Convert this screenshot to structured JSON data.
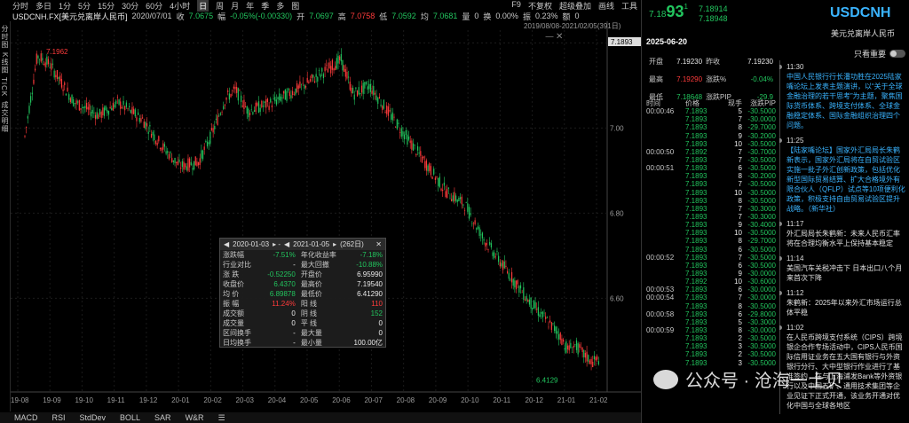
{
  "toolbar": {
    "items": [
      "分时",
      "多日",
      "1分",
      "5分",
      "15分",
      "30分",
      "60分",
      "4小时",
      "日",
      "周",
      "月",
      "年",
      "季",
      "多",
      "图"
    ],
    "active": "日",
    "right": [
      "F9",
      "不复权",
      "超级叠加",
      "画线",
      "工具"
    ]
  },
  "info": {
    "symbol": "USDCNH.FX[美元兑离岸人民币]",
    "date": "2020/07/01",
    "close_label": "收",
    "close": "7.0675",
    "chg_label": "幅",
    "chg": "-0.05%(-0.00330)",
    "open_label": "开",
    "open": "7.0697",
    "high_label": "高",
    "high": "7.0758",
    "low_label": "低",
    "low": "7.0592",
    "prev_label": "均",
    "prev": "7.0681",
    "vol_label": "量",
    "vol": "0",
    "turn_label": "换",
    "turn": "0.00%",
    "amp_label": "振",
    "amp": "0.23%",
    "amt_label": "额",
    "amt": "0"
  },
  "leftrail": [
    "分时图",
    "K线图",
    "TICK",
    "成交明细"
  ],
  "chart": {
    "range_label": "2019/08/08-2021/02/05(391日)",
    "current_price": "7.1893",
    "max_label": "7.1962",
    "min_label": "6.4129",
    "yticks": [
      "7.20",
      "7.00",
      "6.80",
      "6.60"
    ],
    "xticks": [
      "19-08",
      "19-09",
      "19-10",
      "19-11",
      "19-12",
      "20-01",
      "20-02",
      "20-03",
      "20-04",
      "20-05",
      "20-06",
      "20-07",
      "20-08",
      "20-09",
      "20-10",
      "20-11",
      "20-12",
      "21-01",
      "21-02"
    ]
  },
  "stats": {
    "from": "2020-01-03",
    "to": "2021-01-05",
    "days": "(262日)",
    "rows": [
      [
        "涨跌幅",
        "-7.51%",
        "年化收益率",
        "-7.18%"
      ],
      [
        "行业对比",
        "-",
        "最大回撤",
        "-10.88%"
      ],
      [
        "涨 跌",
        "-0.52250",
        "开盘价",
        "6.95990"
      ],
      [
        "收盘价",
        "6.4370",
        "最高价",
        "7.19540"
      ],
      [
        "均 价",
        "6.89878",
        "最低价",
        "6.41290"
      ],
      [
        "振 幅",
        "11.24%",
        "阳 线",
        "110"
      ],
      [
        "成交额",
        "0",
        "阴 线",
        "152"
      ],
      [
        "成交量",
        "0",
        "平 线",
        "0"
      ],
      [
        "区间换手",
        "-",
        "最大量",
        "0"
      ],
      [
        "日均换手",
        "-",
        "最小量",
        "100.00亿"
      ]
    ]
  },
  "bottombar": [
    "MACD",
    "RSI",
    "StdDev",
    "BOLL",
    "SAR",
    "W&R",
    "☰"
  ],
  "quote": {
    "price_a": "7.18",
    "price_b": "93",
    "price_c": "1",
    "ask": "7.18914",
    "bid": "7.18948",
    "symbol": "USDCNH",
    "name": "美元兑离岸人民币",
    "date": "2025-06-20"
  },
  "ohlc": [
    [
      "开盘",
      "7.19230",
      "昨收",
      "7.19230"
    ],
    [
      "最高",
      "7.19290",
      "涨跌%",
      "-0.04%"
    ],
    [
      "最低",
      "7.18648",
      "涨跌PIP",
      "-29.9"
    ]
  ],
  "trades_header": [
    "时间",
    "价格",
    "现手",
    "涨跌PIP"
  ],
  "trades": [
    [
      "00:00:46",
      "7.1893",
      "5",
      "-30.5000"
    ],
    [
      "",
      "7.1893",
      "7",
      "-30.0000"
    ],
    [
      "",
      "7.1893",
      "8",
      "-29.7000"
    ],
    [
      "",
      "7.1893",
      "9",
      "-30.2000"
    ],
    [
      "",
      "7.1893",
      "10",
      "-30.5000"
    ],
    [
      "00:00:50",
      "7.1892",
      "7",
      "-30.7000"
    ],
    [
      "",
      "7.1893",
      "7",
      "-30.5000"
    ],
    [
      "00:00:51",
      "7.1893",
      "6",
      "-30.5000"
    ],
    [
      "",
      "7.1893",
      "8",
      "-30.2000"
    ],
    [
      "",
      "7.1893",
      "7",
      "-30.5000"
    ],
    [
      "",
      "7.1893",
      "10",
      "-30.5000"
    ],
    [
      "",
      "7.1893",
      "8",
      "-30.5000"
    ],
    [
      "",
      "7.1893",
      "7",
      "-30.3000"
    ],
    [
      "",
      "7.1893",
      "7",
      "-30.3000"
    ],
    [
      "",
      "7.1893",
      "9",
      "-30.4000"
    ],
    [
      "",
      "7.1893",
      "10",
      "-30.5000"
    ],
    [
      "",
      "7.1893",
      "8",
      "-29.7000"
    ],
    [
      "",
      "7.1893",
      "6",
      "-30.5000"
    ],
    [
      "00:00:52",
      "7.1893",
      "7",
      "-30.5000"
    ],
    [
      "",
      "7.1893",
      "6",
      "-30.5000"
    ],
    [
      "",
      "7.1893",
      "9",
      "-30.0000"
    ],
    [
      "",
      "7.1892",
      "10",
      "-30.6000"
    ],
    [
      "00:00:53",
      "7.1893",
      "6",
      "-30.0000"
    ],
    [
      "00:00:54",
      "7.1893",
      "7",
      "-30.0000"
    ],
    [
      "",
      "7.1893",
      "8",
      "-30.5000"
    ],
    [
      "00:00:58",
      "7.1893",
      "6",
      "-29.8000"
    ],
    [
      "",
      "7.1893",
      "5",
      "-30.3000"
    ],
    [
      "00:00:59",
      "7.1893",
      "8",
      "-30.0000"
    ],
    [
      "",
      "7.1893",
      "2",
      "-30.5000"
    ],
    [
      "",
      "7.1893",
      "3",
      "-30.5000"
    ],
    [
      "",
      "7.1893",
      "2",
      "-30.5000"
    ],
    [
      "",
      "7.1893",
      "3",
      "-30.5000"
    ]
  ],
  "news": {
    "toggle_label": "只看重要",
    "items": [
      {
        "time": "11:30",
        "text": "中国人民银行行长潘功胜在2025陆家嘴论坛上发表主题演讲，以“关于全球金融治理的若干思考”为主题，聚焦国际货币体系、跨境支付体系、全球金融稳定体系、国际金融组织治理四个问题。",
        "hl": true
      },
      {
        "time": "11:25",
        "text": "【陆家嘴论坛】国家外汇局局长朱鹤新表示，国家外汇局将在自贸试验区实施一批子外汇创新政策，包括优化新型国际贸易结算、扩大合格境外有限合伙人（QFLP）试点等10项便利化政策，积极支持自由贸易试验区提升战略。（新华社）",
        "hl": true
      },
      {
        "time": "11:17",
        "text": "外汇局局长朱鹤新：未来人民币汇率将在合理均衡水平上保持基本稳定",
        "hl": false
      },
      {
        "time": "11:14",
        "text": "美国汽车关税冲击下 日本出口八个月来首次下降",
        "hl": false
      },
      {
        "time": "11:12",
        "text": "朱鹤新：2025年以来外汇市场运行总体平稳",
        "hl": false
      },
      {
        "time": "11:02",
        "text": "在人民币跨境支付系统（CIPS）跨境银企合作专场活动中，CIPS人民币国际信用证业务在五大国有银行与外资银行分行、大中型银行作业进行了基准签约，在与上海浦发Bank等外资银行以及中国五矿、通用技术集团等企业见证下正式开通，该业务开通对优化中国与全球各地区",
        "hl": false
      }
    ]
  },
  "watermark": "公众号 · 沧海一土贝",
  "colors": {
    "up": "#ff3b3b",
    "down": "#22c55e",
    "accent": "#3ab4ff"
  }
}
